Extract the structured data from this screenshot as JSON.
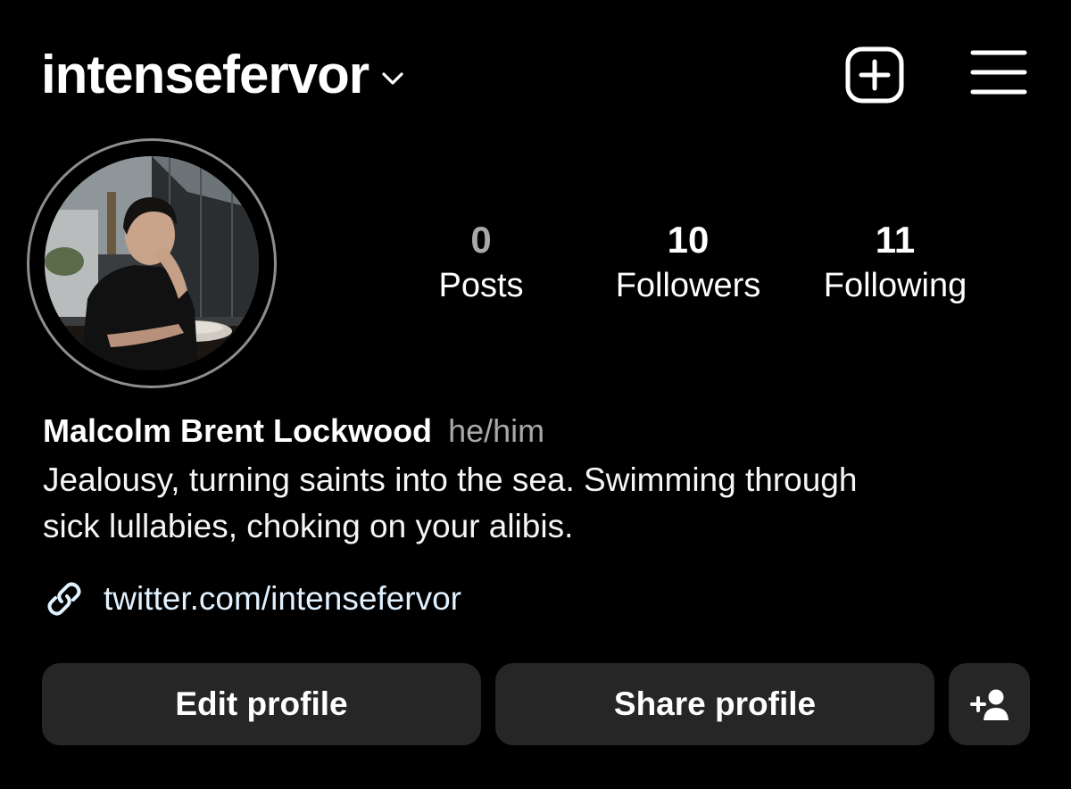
{
  "header": {
    "username": "intensefervor",
    "dropdown_icon": "chevron-down-icon",
    "create_icon": "plus-square-icon",
    "menu_icon": "hamburger-menu-icon"
  },
  "profile": {
    "avatar_description_icon": "profile-photo",
    "stats": {
      "posts": {
        "count": "0",
        "label": "Posts"
      },
      "followers": {
        "count": "10",
        "label": "Followers"
      },
      "following": {
        "count": "11",
        "label": "Following"
      }
    },
    "full_name": "Malcolm Brent Lockwood",
    "pronouns": "he/him",
    "bio_lines": [
      "Jealousy, turning saints into the sea. Swimming through",
      "sick lullabies, choking on your alibis."
    ],
    "link": {
      "icon": "link-icon",
      "text": "twitter.com/intensefervor"
    }
  },
  "actions": {
    "edit_label": "Edit profile",
    "share_label": "Share profile",
    "discover_icon": "add-person-icon"
  },
  "colors": {
    "background": "#000000",
    "button_bg": "#262626",
    "muted_text": "#a8a8a8",
    "link_text": "#e0f1ff",
    "avatar_ring": "#8e8e8e"
  }
}
